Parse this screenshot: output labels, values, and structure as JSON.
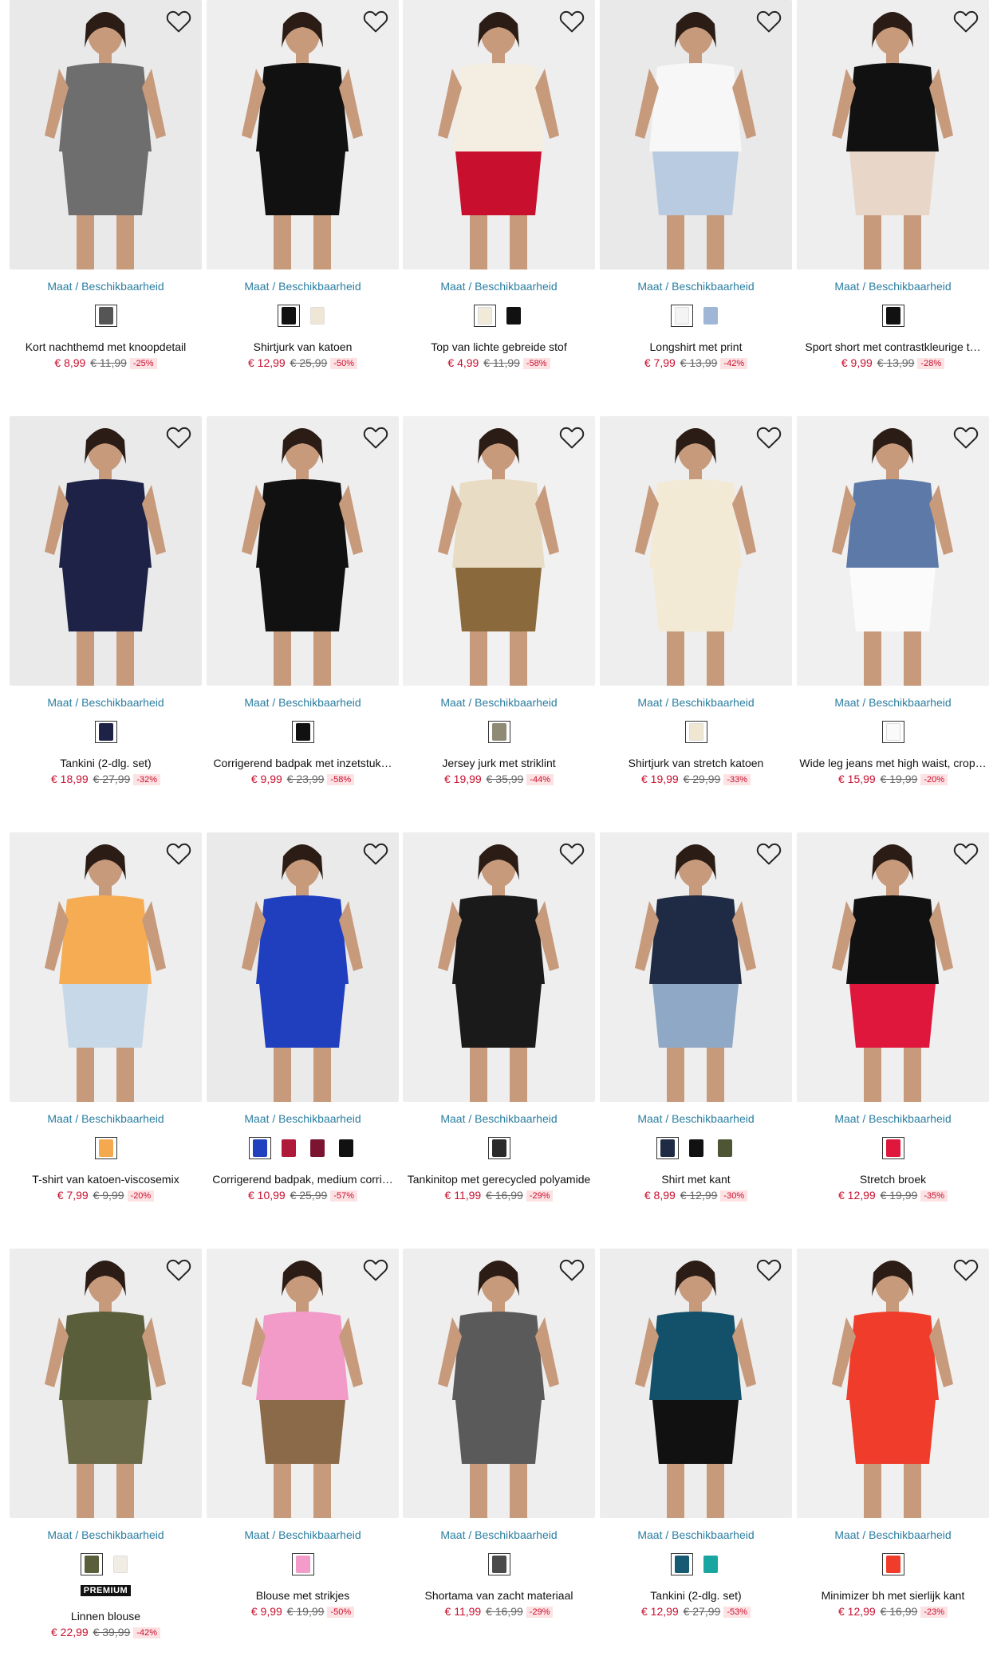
{
  "availability_label": "Maat / Beschikbaarheid",
  "products": [
    {
      "name": "Kort nachthemd met knoopdetail",
      "price": "€ 8,99",
      "old_price": "€ 11,99",
      "discount": "-25%",
      "image_icon": "nightdress-grey",
      "bg": "#e9e9e9",
      "top": "#6e6e6e",
      "bottom": "#6e6e6e",
      "swatches": [
        "#555555"
      ]
    },
    {
      "name": "Shirtjurk van katoen",
      "price": "€ 12,99",
      "old_price": "€ 25,99",
      "discount": "-50%",
      "image_icon": "dress-black",
      "bg": "#eeeeee",
      "top": "#111111",
      "bottom": "#111111",
      "swatches": [
        "#111111",
        "#efe6d6"
      ]
    },
    {
      "name": "Top van lichte gebreide stof",
      "price": "€ 4,99",
      "old_price": "€ 11,99",
      "discount": "-58%",
      "image_icon": "top-cream",
      "bg": "#eeeeee",
      "top": "#f3ede2",
      "bottom": "#c8102e",
      "swatches": [
        "#f1ead8",
        "#111111"
      ]
    },
    {
      "name": "Longshirt met print",
      "price": "€ 7,99",
      "old_price": "€ 13,99",
      "discount": "-42%",
      "image_icon": "tshirt-white",
      "bg": "#e9e9e9",
      "top": "#f7f7f7",
      "bottom": "#b9cbe0",
      "swatches": [
        "#f4f4f4",
        "#9fb6d6"
      ]
    },
    {
      "name": "Sport short met contrastkleurige t…",
      "price": "€ 9,99",
      "old_price": "€ 13,99",
      "discount": "-28%",
      "image_icon": "shorts-black",
      "bg": "#eeeeee",
      "top": "#111111",
      "bottom": "#e8d6c8",
      "swatches": [
        "#111111"
      ]
    },
    {
      "name": "Tankini (2-dlg. set)",
      "price": "€ 18,99",
      "old_price": "€ 27,99",
      "discount": "-32%",
      "image_icon": "tankini-navy",
      "bg": "#eaeaea",
      "top": "#1d2246",
      "bottom": "#1d2246",
      "swatches": [
        "#1d2246"
      ]
    },
    {
      "name": "Corrigerend badpak met inzetstuk…",
      "price": "€ 9,99",
      "old_price": "€ 23,99",
      "discount": "-58%",
      "image_icon": "swimsuit-black",
      "bg": "#eeeeee",
      "top": "#111111",
      "bottom": "#111111",
      "swatches": [
        "#111111"
      ]
    },
    {
      "name": "Jersey jurk met striklint",
      "price": "€ 19,99",
      "old_price": "€ 35,99",
      "discount": "-44%",
      "image_icon": "maxi-dress-print",
      "bg": "#f1f1f1",
      "top": "#e8dcc4",
      "bottom": "#8a6a3c",
      "swatches": [
        "#8f8a76"
      ]
    },
    {
      "name": "Shirtjurk van stretch katoen",
      "price": "€ 19,99",
      "old_price": "€ 29,99",
      "discount": "-33%",
      "image_icon": "dress-cream",
      "bg": "#eeeeee",
      "top": "#f3ead5",
      "bottom": "#f3ead5",
      "swatches": [
        "#efe7d2"
      ]
    },
    {
      "name": "Wide leg jeans met high waist, crop…",
      "price": "€ 15,99",
      "old_price": "€ 19,99",
      "discount": "-20%",
      "image_icon": "jeans-white",
      "bg": "#f0f0f0",
      "top": "#5d79a8",
      "bottom": "#fbfbfb",
      "swatches": [
        "#fafafa"
      ]
    },
    {
      "name": "T-shirt van katoen-viscosemix",
      "price": "€ 7,99",
      "old_price": "€ 9,99",
      "discount": "-20%",
      "image_icon": "tshirt-orange",
      "bg": "#eeeeee",
      "top": "#f6ac52",
      "bottom": "#c7d8e8",
      "swatches": [
        "#f5a94e"
      ]
    },
    {
      "name": "Corrigerend badpak, medium corri…",
      "price": "€ 10,99",
      "old_price": "€ 25,99",
      "discount": "-57%",
      "image_icon": "swimsuit-blue",
      "bg": "#eaeaea",
      "top": "#1f3fbf",
      "bottom": "#1f3fbf",
      "swatches": [
        "#2040c0",
        "#b01a3a",
        "#7a1430",
        "#111111"
      ]
    },
    {
      "name": "Tankinitop met gerecycled polyamide",
      "price": "€ 11,99",
      "old_price": "€ 16,99",
      "discount": "-29%",
      "image_icon": "tankini-floral",
      "bg": "#eeeeee",
      "top": "#1a1a1a",
      "bottom": "#1a1a1a",
      "swatches": [
        "#2a2a2a"
      ]
    },
    {
      "name": "Shirt met kant",
      "price": "€ 8,99",
      "old_price": "€ 12,99",
      "discount": "-30%",
      "image_icon": "shirt-navy",
      "bg": "#eeeeee",
      "top": "#1f2a44",
      "bottom": "#8fa8c6",
      "swatches": [
        "#1f2a44",
        "#111111",
        "#4d5535"
      ]
    },
    {
      "name": "Stretch broek",
      "price": "€ 12,99",
      "old_price": "€ 19,99",
      "discount": "-35%",
      "image_icon": "trousers-red",
      "bg": "#efefef",
      "top": "#111111",
      "bottom": "#e0173d",
      "swatches": [
        "#e0173d"
      ]
    },
    {
      "name": "Linnen blouse",
      "price": "€ 22,99",
      "old_price": "€ 39,99",
      "discount": "-42%",
      "badge": "PREMIUM",
      "image_icon": "blouse-olive",
      "bg": "#ededed",
      "top": "#5b5e3a",
      "bottom": "#6b6b4a",
      "swatches": [
        "#5b5e3a",
        "#f1ede4"
      ]
    },
    {
      "name": "Blouse met strikjes",
      "price": "€ 9,99",
      "old_price": "€ 19,99",
      "discount": "-50%",
      "image_icon": "blouse-pink",
      "bg": "#efefef",
      "top": "#f29ac8",
      "bottom": "#8a6a48",
      "swatches": [
        "#f39cc9"
      ]
    },
    {
      "name": "Shortama van zacht materiaal",
      "price": "€ 11,99",
      "old_price": "€ 16,99",
      "discount": "-29%",
      "image_icon": "shortama-grey",
      "bg": "#eeeeee",
      "top": "#5a5a5a",
      "bottom": "#5a5a5a",
      "swatches": [
        "#4a4a4a"
      ]
    },
    {
      "name": "Tankini (2-dlg. set)",
      "price": "€ 12,99",
      "old_price": "€ 27,99",
      "discount": "-53%",
      "image_icon": "tankini-teal",
      "bg": "#ededed",
      "top": "#13506a",
      "bottom": "#111111",
      "swatches": [
        "#175a74",
        "#1aa6a0"
      ]
    },
    {
      "name": "Minimizer bh met sierlijk kant",
      "price": "€ 12,99",
      "old_price": "€ 16,99",
      "discount": "-23%",
      "image_icon": "bra-red",
      "bg": "#f0f0f0",
      "top": "#f03c2a",
      "bottom": "#f03c2a",
      "swatches": [
        "#f03c2a"
      ]
    }
  ]
}
